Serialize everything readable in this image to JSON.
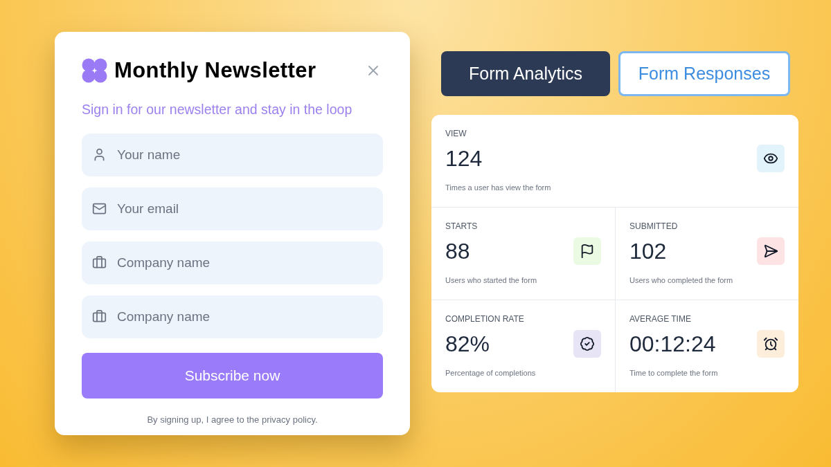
{
  "newsletter": {
    "title": "Monthly Newsletter",
    "subtitle": "Sign in for our newsletter and stay in the loop",
    "fields": [
      {
        "placeholder": "Your name"
      },
      {
        "placeholder": "Your email"
      },
      {
        "placeholder": "Company name"
      },
      {
        "placeholder": "Company name"
      }
    ],
    "submit_button": "Subscribe now",
    "footnote": "By signing up, I agree to the privacy policy."
  },
  "tabs": [
    {
      "label": "Form Analytics",
      "selected": true
    },
    {
      "label": "Form Responses",
      "selected": false
    }
  ],
  "stats": [
    {
      "label": "VIEW",
      "value": "124",
      "description": "Times a user has view the form",
      "color": "#e3f3fc"
    },
    {
      "label": "STARTS",
      "value": "88",
      "description": "Users who started the form",
      "color": "#ebfbe3"
    },
    {
      "label": "SUBMITTED",
      "value": "102",
      "description": "Users who completed the form",
      "color": "#fde3e4"
    },
    {
      "label": "COMPLETION RATE",
      "value": "82%",
      "description": "Percentage of completions",
      "color": "#e7e4f6"
    },
    {
      "label": "AVERAGE TIME",
      "value": "00:12:24",
      "description": "Time to complete the form",
      "color": "#fdeedc"
    }
  ]
}
